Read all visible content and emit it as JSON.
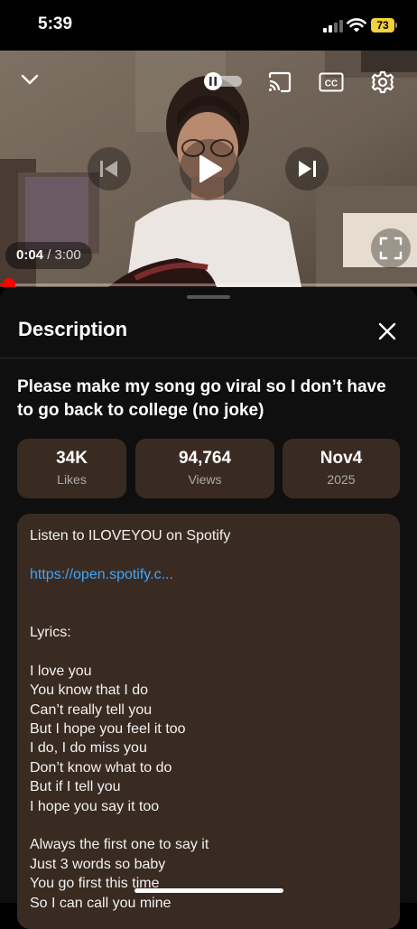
{
  "status_bar": {
    "time": "5:39",
    "battery_level": "73",
    "battery_color": "#f2d13a"
  },
  "player": {
    "current_time": "0:04",
    "total_time": "3:00",
    "separator": " / ",
    "progress_fraction": 0.022,
    "progress_color": "#ff0000",
    "autoplay_enabled": false,
    "icons": {
      "collapse": "chevron-down-icon",
      "autoplay": "autoplay-toggle-icon",
      "cast": "cast-icon",
      "captions": "captions-icon",
      "settings": "gear-icon",
      "previous": "skip-previous-icon",
      "play": "play-icon",
      "next": "skip-next-icon",
      "fullscreen": "fullscreen-icon"
    }
  },
  "description_panel": {
    "title": "Description",
    "close_icon": "close-icon",
    "video_title": "Please make my song go viral so I don’t have to go back to college (no joke)",
    "stats": [
      {
        "value": "34K",
        "label": "Likes"
      },
      {
        "value": "94,764",
        "label": "Views"
      },
      {
        "value": "Nov4",
        "label": "2025"
      }
    ],
    "description": {
      "intro": "Listen to ILOVEYOU on Spotify",
      "link": "https://open.spotify.c...",
      "lyrics_header": "Lyrics:",
      "verse1": [
        "I love you",
        "You know that I do",
        "Can’t really tell you",
        "But I hope you feel it too",
        "I do, I do miss you",
        "Don’t know what to do",
        "But if I tell you",
        "I hope you say it too"
      ],
      "verse2": [
        "Always the first one to say it",
        "Just 3 words so baby",
        "You go first this time",
        "So I can call you mine"
      ]
    },
    "card_color": "#3a2b22",
    "link_color": "#3ea6ff"
  }
}
